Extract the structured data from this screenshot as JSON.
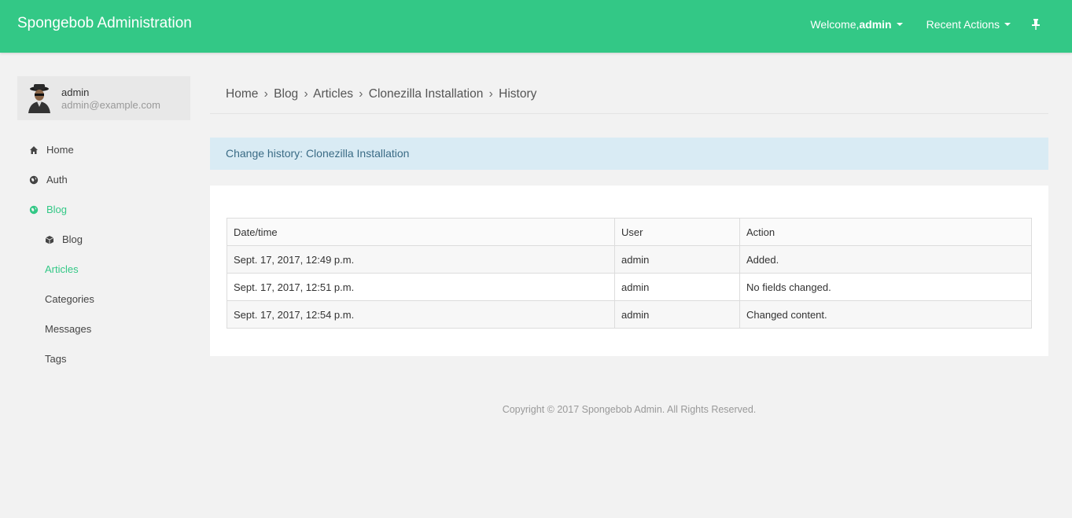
{
  "colors": {
    "brand": "#33c886",
    "accent": "#33c886",
    "info_bg": "#d9ebf4"
  },
  "navbar": {
    "brand": "Spongebob Administration",
    "welcome_prefix": "Welcome, ",
    "welcome_user": "admin",
    "recent_actions": "Recent Actions",
    "pin_icon": "pin-icon"
  },
  "user": {
    "name": "admin",
    "email": "admin@example.com"
  },
  "sidebar": {
    "items": [
      {
        "label": "Home",
        "icon": "home-icon"
      },
      {
        "label": "Auth",
        "icon": "globe-icon"
      },
      {
        "label": "Blog",
        "icon": "globe-icon"
      },
      {
        "label": "Blog",
        "icon": "cube-icon"
      },
      {
        "label": "Articles"
      },
      {
        "label": "Categories"
      },
      {
        "label": "Messages"
      },
      {
        "label": "Tags"
      }
    ]
  },
  "breadcrumb": {
    "items": [
      "Home",
      "Blog",
      "Articles",
      "Clonezilla Installation",
      "History"
    ],
    "separator": "›"
  },
  "info": {
    "text": "Change history: Clonezilla Installation"
  },
  "history_table": {
    "headers": [
      "Date/time",
      "User",
      "Action"
    ],
    "rows": [
      [
        "Sept. 17, 2017, 12:49 p.m.",
        "admin",
        "Added."
      ],
      [
        "Sept. 17, 2017, 12:51 p.m.",
        "admin",
        "No fields changed."
      ],
      [
        "Sept. 17, 2017, 12:54 p.m.",
        "admin",
        "Changed content."
      ]
    ]
  },
  "footer": {
    "text": "Copyright © 2017 Spongebob Admin. All Rights Reserved."
  }
}
